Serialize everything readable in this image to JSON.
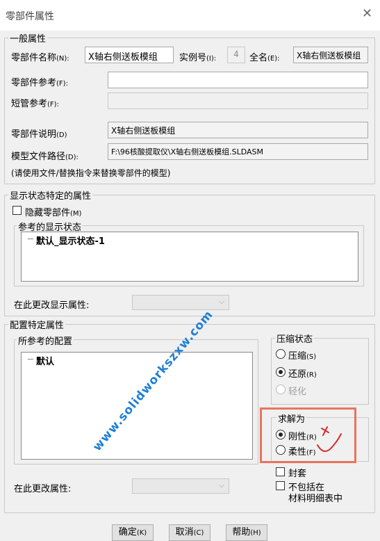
{
  "window": {
    "title": "零部件属性",
    "close_glyph": "✕"
  },
  "general": {
    "legend": "一般属性",
    "name_label": "零部件名称",
    "name_shortcut": "(N):",
    "name_value": "X轴右侧送板模组",
    "instance_label": "实例号",
    "instance_shortcut": "(I):",
    "instance_value": "4",
    "fullname_label": "全名",
    "fullname_shortcut": "(E):",
    "fullname_value": "X轴右侧送板模组",
    "ref_label": "零部件参考",
    "ref_shortcut": "(F):",
    "ref_value": "",
    "pipe_label": "短管参考",
    "pipe_shortcut": "(F):",
    "pipe_value": "",
    "desc_label": "零部件说明",
    "desc_shortcut": "(D)",
    "desc_value": "X轴右侧送板模组",
    "path_label": "模型文件路径",
    "path_shortcut": "(D):",
    "path_value": "F:\\96核酸提取仪\\X轴右侧送板模组.SLDASM",
    "hint": "(请使用文件/替换指令来替换零部件的模型)"
  },
  "display": {
    "legend": "显示状态特定的属性",
    "hide_label": "隐藏零部件",
    "hide_shortcut": "(M)",
    "ref_states_legend": "参考的显示状态",
    "state_item": "默认_显示状态-1",
    "change_label": "在此更改显示属性:",
    "change_value": ""
  },
  "config": {
    "legend": "配置特定属性",
    "ref_config_legend": "所参考的配置",
    "config_item": "默认",
    "change_label": "在此更改属性:",
    "change_value": "",
    "suppress": {
      "legend": "压缩状态",
      "compress": "压缩",
      "compress_shortcut": "(S)",
      "restore": "还原",
      "restore_shortcut": "(R)",
      "lightweight": "轻化"
    },
    "solve": {
      "legend": "求解为",
      "rigid": "刚性",
      "rigid_shortcut": "(R)",
      "flexible": "柔性",
      "flexible_shortcut": "(F)"
    },
    "envelope": "封套",
    "exclude_bom_line1": "不包括在",
    "exclude_bom_line2": "材料明细表中"
  },
  "buttons": {
    "ok": "确定",
    "ok_shortcut": "(K)",
    "cancel": "取消",
    "cancel_shortcut": "(C)",
    "help": "帮助",
    "help_shortcut": "(H)"
  },
  "watermark": "www.solidworkszxw.com",
  "colors": {
    "highlight": "#e8735e",
    "watermark": "#1e7fd6",
    "annotation": "#d42c2c"
  }
}
